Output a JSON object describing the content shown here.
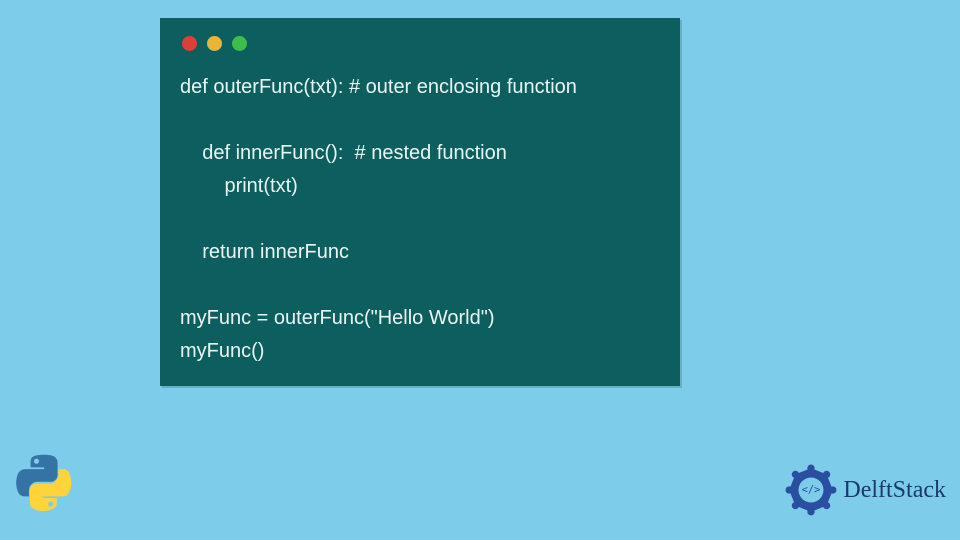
{
  "code": {
    "line1": "def outerFunc(txt): # outer enclosing function",
    "blank1": "",
    "line2": "    def innerFunc():  # nested function",
    "line3": "        print(txt)",
    "blank2": "",
    "line4": "    return innerFunc",
    "blank3": "",
    "line5": "myFunc = outerFunc(\"Hello World\")",
    "line6": "myFunc()"
  },
  "brand": {
    "name": "DelftStack"
  },
  "colors": {
    "page_bg": "#7cccea",
    "box_bg": "#0d5e5e",
    "code_fg": "#eaf6f6",
    "brand_fg": "#1b3a6b"
  }
}
